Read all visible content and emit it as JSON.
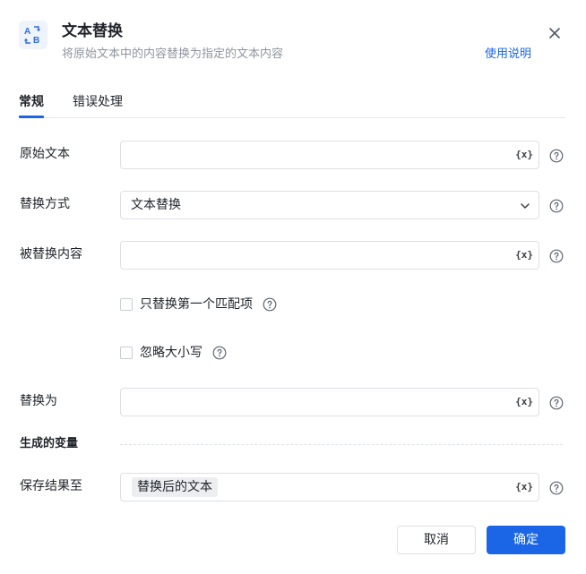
{
  "header": {
    "title": "文本替换",
    "subtitle": "将原始文本中的内容替换为指定的文本内容",
    "help_link": "使用说明",
    "icon": "text-replace-icon"
  },
  "tabs": [
    {
      "label": "常规",
      "active": true
    },
    {
      "label": "错误处理",
      "active": false
    }
  ],
  "form": {
    "original_text": {
      "label": "原始文本",
      "value": ""
    },
    "replace_mode": {
      "label": "替换方式",
      "value": "文本替换"
    },
    "replaced_content": {
      "label": "被替换内容",
      "value": ""
    },
    "first_match_only": {
      "label": "只替换第一个匹配项",
      "checked": false
    },
    "ignore_case": {
      "label": "忽略大小写",
      "checked": false
    },
    "replace_with": {
      "label": "替换为",
      "value": ""
    },
    "variable_button": "{x}"
  },
  "output": {
    "section_title": "生成的变量",
    "save_to": {
      "label": "保存结果至",
      "tag": "替换后的文本"
    }
  },
  "footer": {
    "cancel_label": "取消",
    "ok_label": "确定"
  },
  "colors": {
    "accent": "#1a66e6",
    "border": "#dcdfe6",
    "muted_text": "#8f959e"
  }
}
